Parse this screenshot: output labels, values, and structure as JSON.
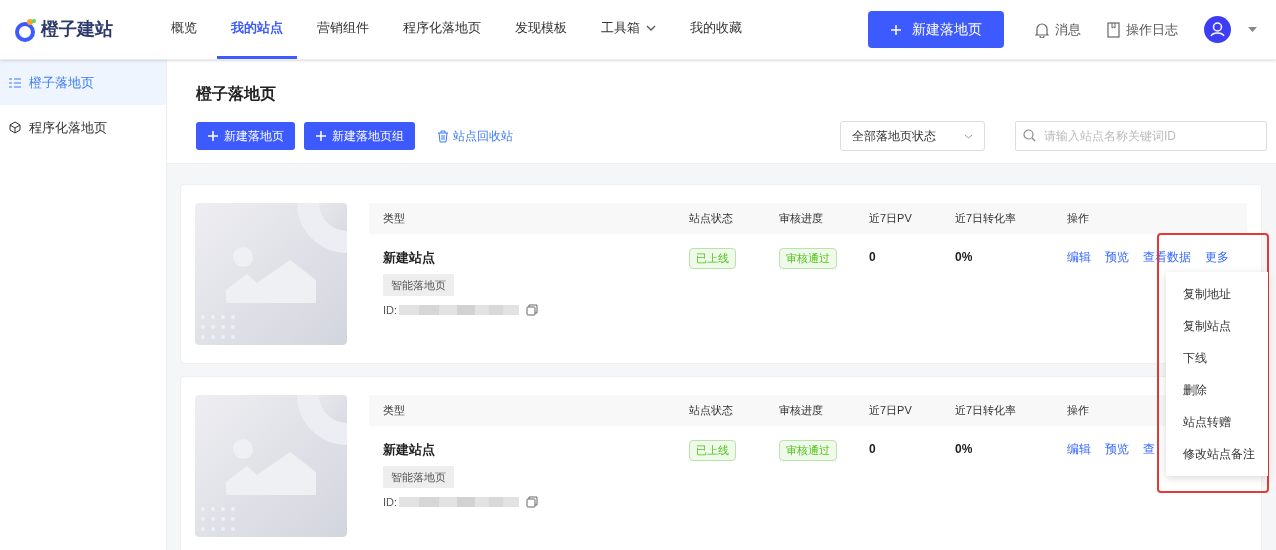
{
  "logo": {
    "text": "橙子建站"
  },
  "nav": [
    {
      "label": "概览",
      "selected": false,
      "dropdown": false
    },
    {
      "label": "我的站点",
      "selected": true,
      "dropdown": false
    },
    {
      "label": "营销组件",
      "selected": false,
      "dropdown": false
    },
    {
      "label": "程序化落地页",
      "selected": false,
      "dropdown": false
    },
    {
      "label": "发现模板",
      "selected": false,
      "dropdown": false
    },
    {
      "label": "工具箱",
      "selected": false,
      "dropdown": true
    },
    {
      "label": "我的收藏",
      "selected": false,
      "dropdown": false
    }
  ],
  "header_button": {
    "label": "新建落地页"
  },
  "header_actions": [
    {
      "kind": "bell",
      "label": "消息"
    },
    {
      "kind": "log",
      "label": "操作日志"
    }
  ],
  "sidebar": {
    "items": [
      {
        "kind": "list",
        "label": "橙子落地页",
        "selected": true
      },
      {
        "kind": "cube",
        "label": "程序化落地页",
        "selected": false
      }
    ]
  },
  "page_title": "橙子落地页",
  "toolbar": {
    "primary_buttons": [
      "新建落地页",
      "新建落地页组"
    ],
    "recycle_link": "站点回收站"
  },
  "status_filter": {
    "value": "全部落地页状态"
  },
  "search": {
    "placeholder": "请输入站点名称关键词ID"
  },
  "sites": [
    {
      "columns": [
        "类型",
        "站点状态",
        "审核进度",
        "近7日PV",
        "近7日转化率",
        "操作"
      ],
      "name": "新建站点",
      "type_tag": "智能落地页",
      "id_label": "ID:",
      "status": "已上线",
      "review": "审核通过",
      "pv": "0",
      "rate": "0%",
      "actions": [
        "编辑",
        "预览",
        "查看数据",
        "更多"
      ]
    },
    {
      "columns": [
        "类型",
        "站点状态",
        "审核进度",
        "近7日PV",
        "近7日转化率",
        "操作"
      ],
      "name": "新建站点",
      "type_tag": "智能落地页",
      "id_label": "ID:",
      "status": "已上线",
      "review": "审核通过",
      "pv": "0",
      "rate": "0%",
      "actions": [
        "编辑",
        "预览",
        "查"
      ]
    }
  ],
  "more_menu": {
    "items": [
      "复制地址",
      "复制站点",
      "下线",
      "删除",
      "站点转赠",
      "修改站点备注"
    ]
  }
}
